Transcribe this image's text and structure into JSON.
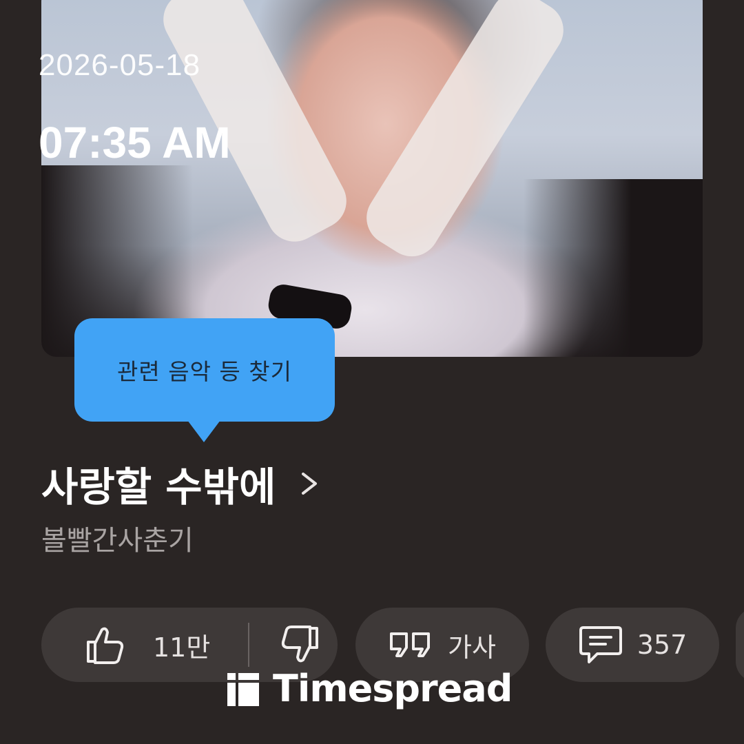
{
  "overlay": {
    "date": "2026-05-18",
    "time": "07:35 AM"
  },
  "tooltip": {
    "text": "관련 음악 등 찾기"
  },
  "song": {
    "title": "사랑할 수밖에",
    "artist": "볼빨간사춘기"
  },
  "actions": {
    "like_count": "11만",
    "lyrics_label": "가사",
    "comment_count": "357"
  },
  "watermark": {
    "brand": "Timespread"
  },
  "colors": {
    "background": "#2a2524",
    "chip": "#3e3938",
    "tooltip": "#41a3f5",
    "secondary_text": "#a9a4a3"
  }
}
